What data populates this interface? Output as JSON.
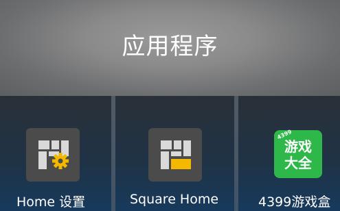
{
  "header": {
    "title": "应用程序"
  },
  "apps": [
    {
      "label": "Home 设置",
      "icon": "home-settings-icon"
    },
    {
      "label": "Square Home",
      "icon": "square-home-icon"
    },
    {
      "label": "4399游戏盒",
      "icon": "4399-game-box-icon",
      "icon_text_top": "游戏",
      "icon_text_bottom": "大全",
      "icon_badge": "4399"
    }
  ],
  "colors": {
    "accent": "#f5b800",
    "game_green": "#2fb84a"
  }
}
